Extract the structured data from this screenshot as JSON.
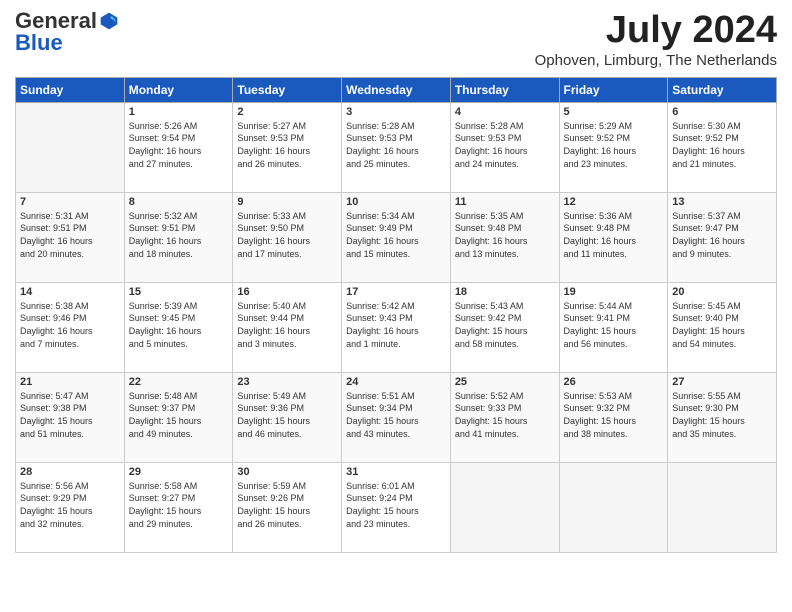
{
  "header": {
    "logo_general": "General",
    "logo_blue": "Blue",
    "month_year": "July 2024",
    "location": "Ophoven, Limburg, The Netherlands"
  },
  "days_of_week": [
    "Sunday",
    "Monday",
    "Tuesday",
    "Wednesday",
    "Thursday",
    "Friday",
    "Saturday"
  ],
  "weeks": [
    [
      {
        "day": "",
        "info": ""
      },
      {
        "day": "1",
        "info": "Sunrise: 5:26 AM\nSunset: 9:54 PM\nDaylight: 16 hours\nand 27 minutes."
      },
      {
        "day": "2",
        "info": "Sunrise: 5:27 AM\nSunset: 9:53 PM\nDaylight: 16 hours\nand 26 minutes."
      },
      {
        "day": "3",
        "info": "Sunrise: 5:28 AM\nSunset: 9:53 PM\nDaylight: 16 hours\nand 25 minutes."
      },
      {
        "day": "4",
        "info": "Sunrise: 5:28 AM\nSunset: 9:53 PM\nDaylight: 16 hours\nand 24 minutes."
      },
      {
        "day": "5",
        "info": "Sunrise: 5:29 AM\nSunset: 9:52 PM\nDaylight: 16 hours\nand 23 minutes."
      },
      {
        "day": "6",
        "info": "Sunrise: 5:30 AM\nSunset: 9:52 PM\nDaylight: 16 hours\nand 21 minutes."
      }
    ],
    [
      {
        "day": "7",
        "info": "Sunrise: 5:31 AM\nSunset: 9:51 PM\nDaylight: 16 hours\nand 20 minutes."
      },
      {
        "day": "8",
        "info": "Sunrise: 5:32 AM\nSunset: 9:51 PM\nDaylight: 16 hours\nand 18 minutes."
      },
      {
        "day": "9",
        "info": "Sunrise: 5:33 AM\nSunset: 9:50 PM\nDaylight: 16 hours\nand 17 minutes."
      },
      {
        "day": "10",
        "info": "Sunrise: 5:34 AM\nSunset: 9:49 PM\nDaylight: 16 hours\nand 15 minutes."
      },
      {
        "day": "11",
        "info": "Sunrise: 5:35 AM\nSunset: 9:48 PM\nDaylight: 16 hours\nand 13 minutes."
      },
      {
        "day": "12",
        "info": "Sunrise: 5:36 AM\nSunset: 9:48 PM\nDaylight: 16 hours\nand 11 minutes."
      },
      {
        "day": "13",
        "info": "Sunrise: 5:37 AM\nSunset: 9:47 PM\nDaylight: 16 hours\nand 9 minutes."
      }
    ],
    [
      {
        "day": "14",
        "info": "Sunrise: 5:38 AM\nSunset: 9:46 PM\nDaylight: 16 hours\nand 7 minutes."
      },
      {
        "day": "15",
        "info": "Sunrise: 5:39 AM\nSunset: 9:45 PM\nDaylight: 16 hours\nand 5 minutes."
      },
      {
        "day": "16",
        "info": "Sunrise: 5:40 AM\nSunset: 9:44 PM\nDaylight: 16 hours\nand 3 minutes."
      },
      {
        "day": "17",
        "info": "Sunrise: 5:42 AM\nSunset: 9:43 PM\nDaylight: 16 hours\nand 1 minute."
      },
      {
        "day": "18",
        "info": "Sunrise: 5:43 AM\nSunset: 9:42 PM\nDaylight: 15 hours\nand 58 minutes."
      },
      {
        "day": "19",
        "info": "Sunrise: 5:44 AM\nSunset: 9:41 PM\nDaylight: 15 hours\nand 56 minutes."
      },
      {
        "day": "20",
        "info": "Sunrise: 5:45 AM\nSunset: 9:40 PM\nDaylight: 15 hours\nand 54 minutes."
      }
    ],
    [
      {
        "day": "21",
        "info": "Sunrise: 5:47 AM\nSunset: 9:38 PM\nDaylight: 15 hours\nand 51 minutes."
      },
      {
        "day": "22",
        "info": "Sunrise: 5:48 AM\nSunset: 9:37 PM\nDaylight: 15 hours\nand 49 minutes."
      },
      {
        "day": "23",
        "info": "Sunrise: 5:49 AM\nSunset: 9:36 PM\nDaylight: 15 hours\nand 46 minutes."
      },
      {
        "day": "24",
        "info": "Sunrise: 5:51 AM\nSunset: 9:34 PM\nDaylight: 15 hours\nand 43 minutes."
      },
      {
        "day": "25",
        "info": "Sunrise: 5:52 AM\nSunset: 9:33 PM\nDaylight: 15 hours\nand 41 minutes."
      },
      {
        "day": "26",
        "info": "Sunrise: 5:53 AM\nSunset: 9:32 PM\nDaylight: 15 hours\nand 38 minutes."
      },
      {
        "day": "27",
        "info": "Sunrise: 5:55 AM\nSunset: 9:30 PM\nDaylight: 15 hours\nand 35 minutes."
      }
    ],
    [
      {
        "day": "28",
        "info": "Sunrise: 5:56 AM\nSunset: 9:29 PM\nDaylight: 15 hours\nand 32 minutes."
      },
      {
        "day": "29",
        "info": "Sunrise: 5:58 AM\nSunset: 9:27 PM\nDaylight: 15 hours\nand 29 minutes."
      },
      {
        "day": "30",
        "info": "Sunrise: 5:59 AM\nSunset: 9:26 PM\nDaylight: 15 hours\nand 26 minutes."
      },
      {
        "day": "31",
        "info": "Sunrise: 6:01 AM\nSunset: 9:24 PM\nDaylight: 15 hours\nand 23 minutes."
      },
      {
        "day": "",
        "info": ""
      },
      {
        "day": "",
        "info": ""
      },
      {
        "day": "",
        "info": ""
      }
    ]
  ]
}
